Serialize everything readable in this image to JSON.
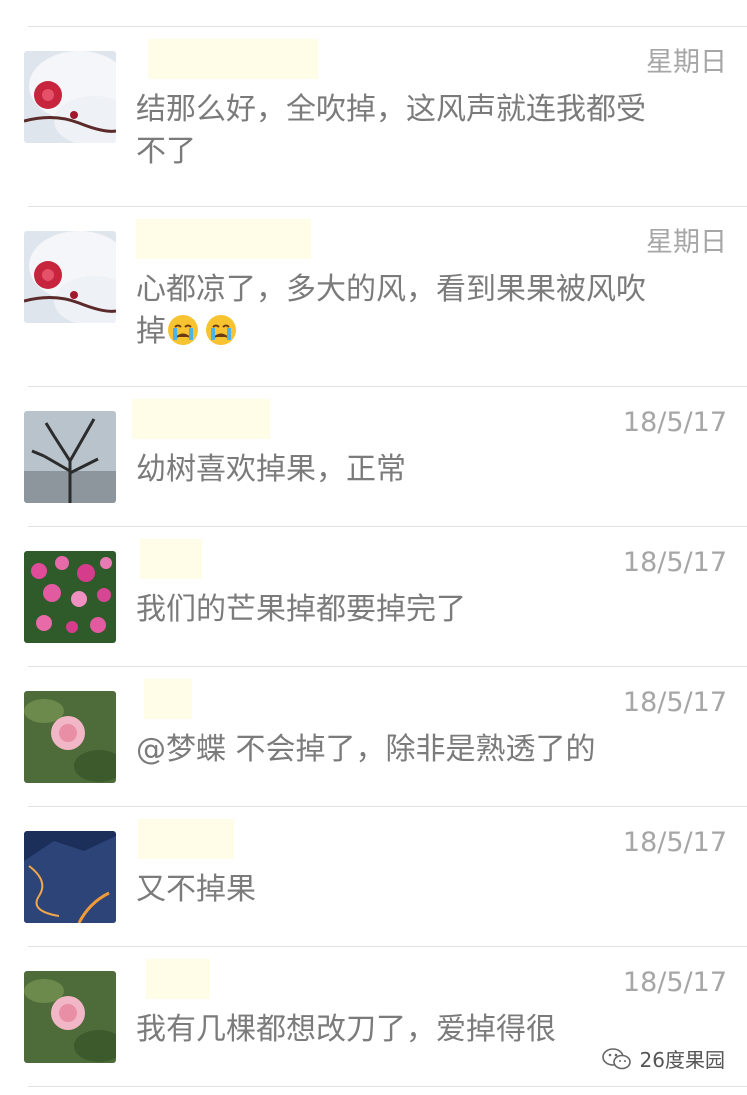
{
  "chats": [
    {
      "name": "",
      "time": "星期日",
      "message": "结那么好，全吹掉，这风声就连我都受不了",
      "emoji_count": 0,
      "avatar": "snow-plum"
    },
    {
      "name": "",
      "time": "星期日",
      "message": "心都凉了，多大的风，看到果果被风吹掉",
      "emoji_count": 2,
      "avatar": "snow-plum"
    },
    {
      "name": "",
      "time": "18/5/17",
      "message": "幼树喜欢掉果，正常",
      "emoji_count": 0,
      "avatar": "bare-tree"
    },
    {
      "name": "",
      "time": "18/5/17",
      "message": "我们的芒果掉都要掉完了",
      "emoji_count": 0,
      "avatar": "roses"
    },
    {
      "name": "",
      "time": "18/5/17",
      "message": "@梦蝶 不会掉了，除非是熟透了的",
      "emoji_count": 0,
      "avatar": "pink-rose"
    },
    {
      "name": "",
      "time": "18/5/17",
      "message": "又不掉果",
      "emoji_count": 0,
      "avatar": "night-mountain"
    },
    {
      "name": "",
      "time": "18/5/17",
      "message": "我有几棵都想改刀了，爱掉得很",
      "emoji_count": 0,
      "avatar": "pink-rose"
    }
  ],
  "watermark": {
    "text": "26度果园",
    "icon": "wechat-icon"
  },
  "colors": {
    "time": "#a6a6a6",
    "message": "#7b7b7b",
    "divider": "#e2e2e2",
    "mask": "#fffde8"
  }
}
